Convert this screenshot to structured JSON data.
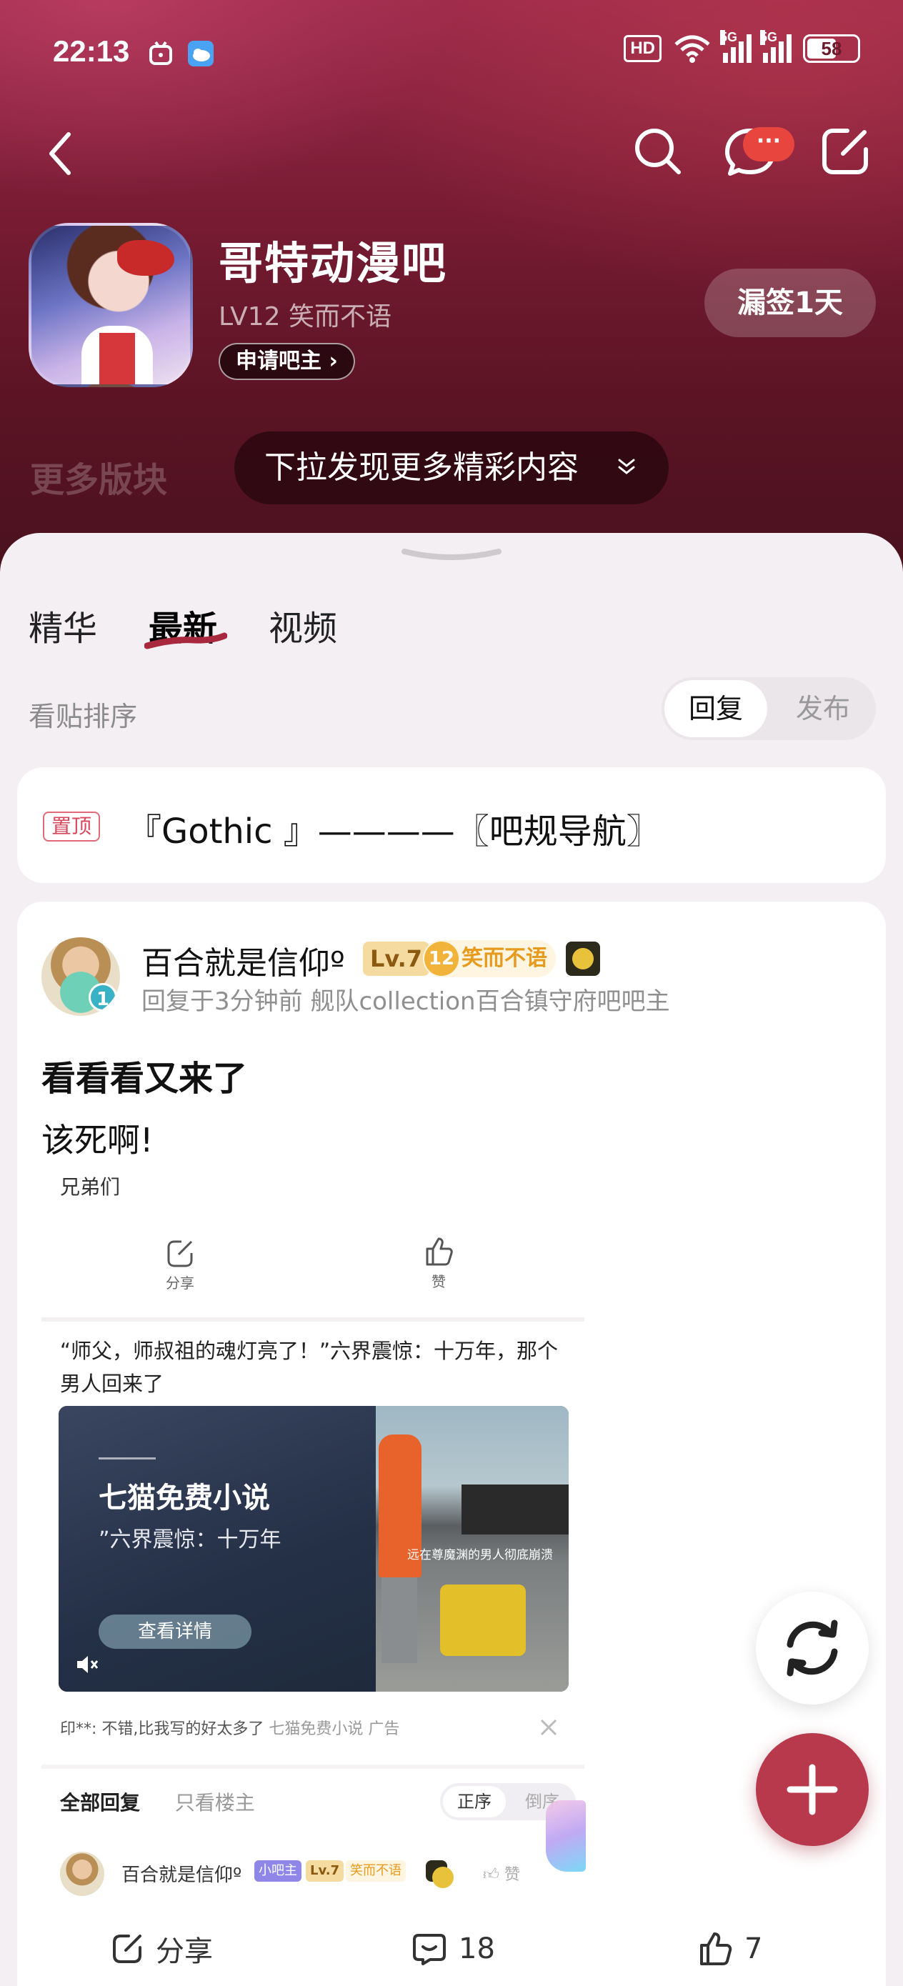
{
  "status_bar": {
    "time": "22:13",
    "hd_label": "HD",
    "net_label_1": "5G",
    "net_label_2": "5G",
    "battery": "58",
    "battery_level": 0.58
  },
  "forum": {
    "name": "哥特动漫吧",
    "level": "LV12 笑而不语",
    "apply_moderator": "申请吧主",
    "checkin": "漏签1天",
    "more_sections": "更多版块",
    "pulldown_hint": "下拉发现更多精彩内容"
  },
  "header": {
    "message_badge": "···"
  },
  "tabs": [
    {
      "label": "精华"
    },
    {
      "label": "最新",
      "active": true
    },
    {
      "label": "视频"
    }
  ],
  "sort": {
    "label": "看贴排序",
    "options": [
      "回复",
      "发布"
    ],
    "selected": "回复"
  },
  "pinned": {
    "badge": "置顶",
    "title": "『Gothic 』————〖吧规导航〗"
  },
  "post": {
    "author": "百合就是信仰º",
    "level_badge": "Lv.7",
    "title_badge_num": "12",
    "title_badge": "笑而不语",
    "avatar_badge": "1",
    "meta": "回复于3分钟前    舰队collection百合镇守府吧吧主",
    "title": "看看看又来了",
    "body": "该死啊!",
    "embedded": {
      "text": "兄弟们",
      "share": "分享",
      "like": "赞",
      "quote": "“师父，师叔祖的魂灯亮了！”六界震惊：十万年，那个男人回来了",
      "ad_name": "七猫免费小说",
      "ad_sub": "”六界震惊：十万年",
      "ad_button": "查看详情",
      "ad_caption": "远在尊魔渊的男人彻底崩溃",
      "ad_comment": "印**: 不错,比我写的好太多了",
      "ad_source": "七猫免费小说  广告",
      "reply_tab_all": "全部回复",
      "reply_tab_owner": "只看楼主",
      "order_asc": "正序",
      "order_desc": "倒序",
      "reply_name": "百合就是信仰º",
      "reply_tag_mod": "小吧主",
      "reply_tag_lv": "Lv.7",
      "reply_tag_title": "笑而不语",
      "reply_like": "赞"
    }
  },
  "actions": {
    "share": "分享",
    "comments": "18",
    "likes": "7"
  },
  "colors": {
    "brand": "#b8394c",
    "hero_dark": "#5b1424",
    "pin_badge": "#d8485c",
    "level_badge_bg": "#f6dba0",
    "title_badge_fg": "#e79b1e"
  }
}
